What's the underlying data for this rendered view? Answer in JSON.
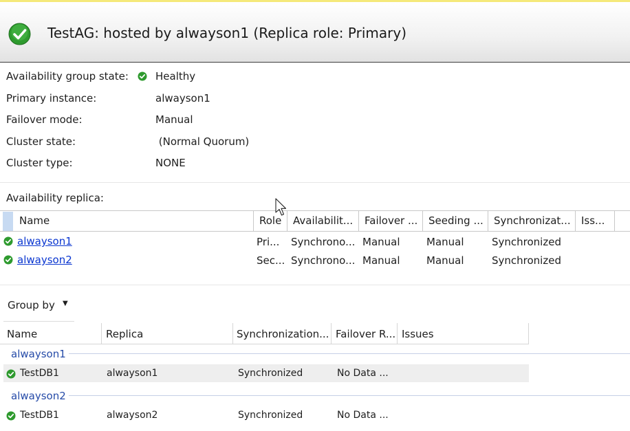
{
  "header": {
    "title": "TestAG: hosted by alwayson1 (Replica role: Primary)",
    "status_icon": "check-circle-icon",
    "colors": {
      "check_green": "#2e9a2e",
      "top_accent": "#f5e97a"
    }
  },
  "properties": [
    {
      "label": "Availability group state:",
      "value": "Healthy",
      "icon": "check-circle-icon"
    },
    {
      "label": "Primary instance:",
      "value": "alwayson1"
    },
    {
      "label": "Failover mode:",
      "value": "Manual"
    },
    {
      "label": "Cluster state:",
      "value": " (Normal Quorum)"
    },
    {
      "label": "Cluster type:",
      "value": "NONE"
    }
  ],
  "replicas_section": {
    "label": "Availability replica:",
    "columns": [
      "Name",
      "Role",
      "Availabilit...",
      "Failover ...",
      "Seeding ...",
      "Synchronizat...",
      "Iss..."
    ],
    "rows": [
      {
        "name": "alwayson1",
        "role": "Pri...",
        "availability": "Synchrono...",
        "failover": "Manual",
        "seeding": "Manual",
        "sync": "Synchronized",
        "issues": ""
      },
      {
        "name": "alwayson2",
        "role": "Sec...",
        "availability": "Synchrono...",
        "failover": "Manual",
        "seeding": "Manual",
        "sync": "Synchronized",
        "issues": ""
      }
    ]
  },
  "databases_section": {
    "group_by_label": "Group by",
    "columns": [
      "Name",
      "Replica",
      "Synchronization...",
      "Failover R...",
      "Issues"
    ],
    "groups": [
      {
        "label": "alwayson1",
        "rows": [
          {
            "name": "TestDB1",
            "replica": "alwayson1",
            "sync": "Synchronized",
            "failover_readiness": "No Data ..."
          }
        ]
      },
      {
        "label": "alwayson2",
        "rows": [
          {
            "name": "TestDB1",
            "replica": "alwayson2",
            "sync": "Synchronized",
            "failover_readiness": "No Data ..."
          }
        ]
      }
    ]
  }
}
